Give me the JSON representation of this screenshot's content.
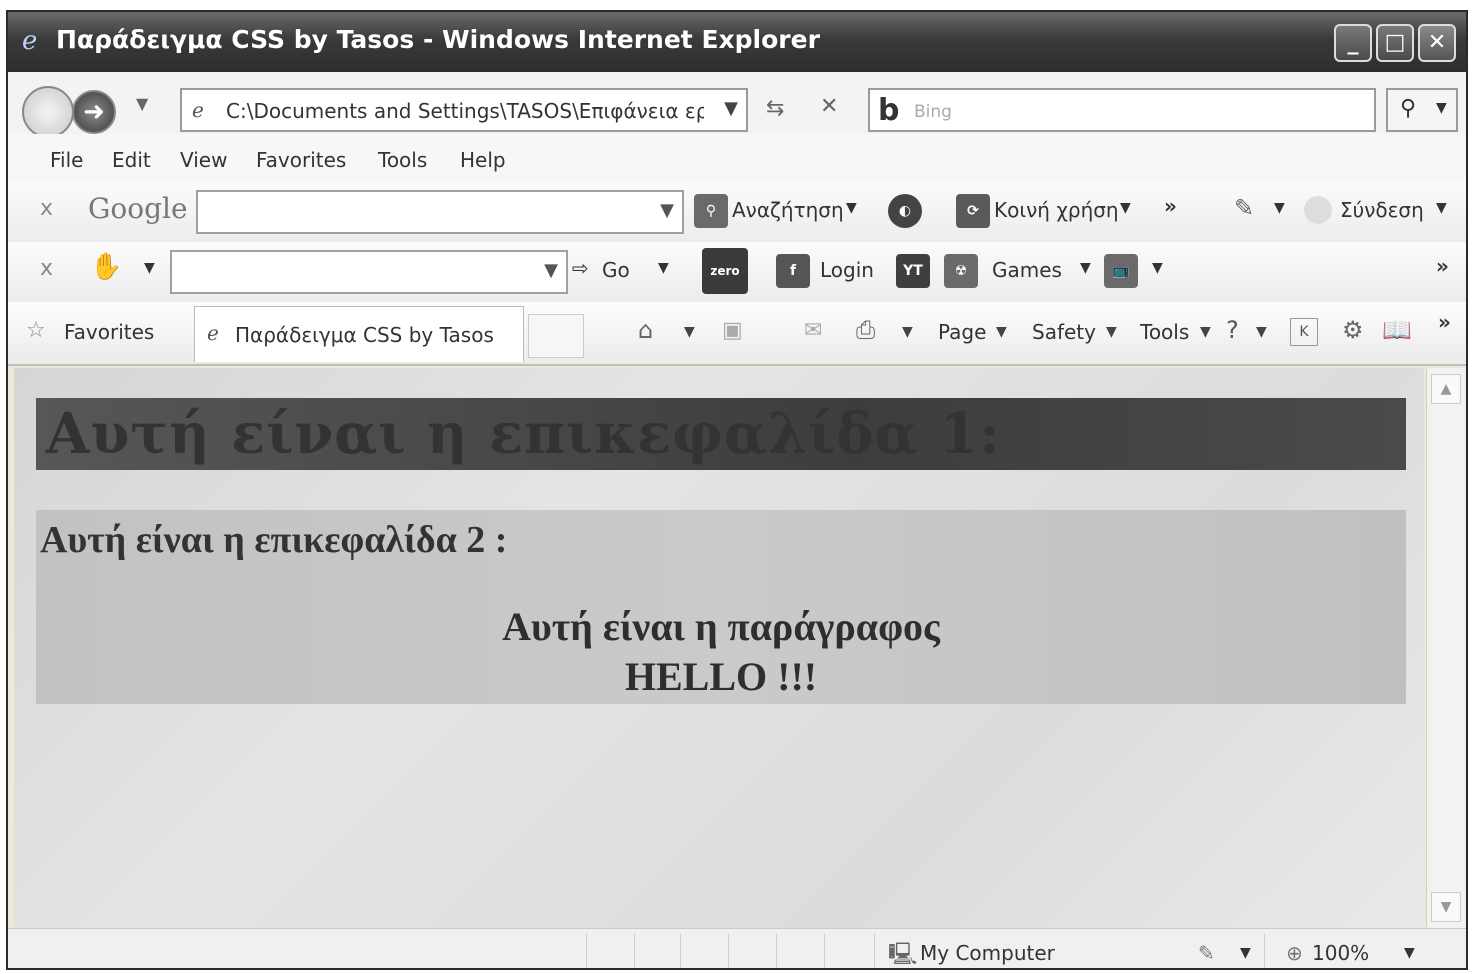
{
  "window": {
    "title": "Παράδειγμα CSS by Tasos - Windows Internet Explorer",
    "minimize": "_",
    "maximize": "□",
    "close": "✕"
  },
  "address": {
    "url": "C:\\Documents and Settings\\TASOS\\Επιφάνεια εργα",
    "search_placeholder": "Bing",
    "search_icon": "search-icon"
  },
  "menu": {
    "items": [
      "File",
      "Edit",
      "View",
      "Favorites",
      "Tools",
      "Help"
    ]
  },
  "google_toolbar": {
    "logo": "Google",
    "search_button": "Αναζήτηση",
    "share_button": "Κοινή χρήση",
    "more": "»",
    "signin_button": "Σύνδεση"
  },
  "second_toolbar": {
    "go_label": "Go",
    "zero_label": "zero",
    "login_label": "Login",
    "yt_label": "YT",
    "games_label": "Games",
    "more": "»"
  },
  "favorites_bar": {
    "favorites_label": "Favorites",
    "tab_title": "Παράδειγμα CSS by Tasos",
    "page_menu": "Page",
    "safety_menu": "Safety",
    "tools_menu": "Tools",
    "more": "»"
  },
  "page": {
    "heading1": "Αυτή είναι η επικεφαλίδα 1:",
    "heading2": "Αυτή είναι η επικεφαλίδα 2 :",
    "paragraph_line1": "Αυτή είναι η παράγραφος",
    "paragraph_line2": "HELLO !!!"
  },
  "status": {
    "zone": "My Computer",
    "zoom": "100%"
  }
}
